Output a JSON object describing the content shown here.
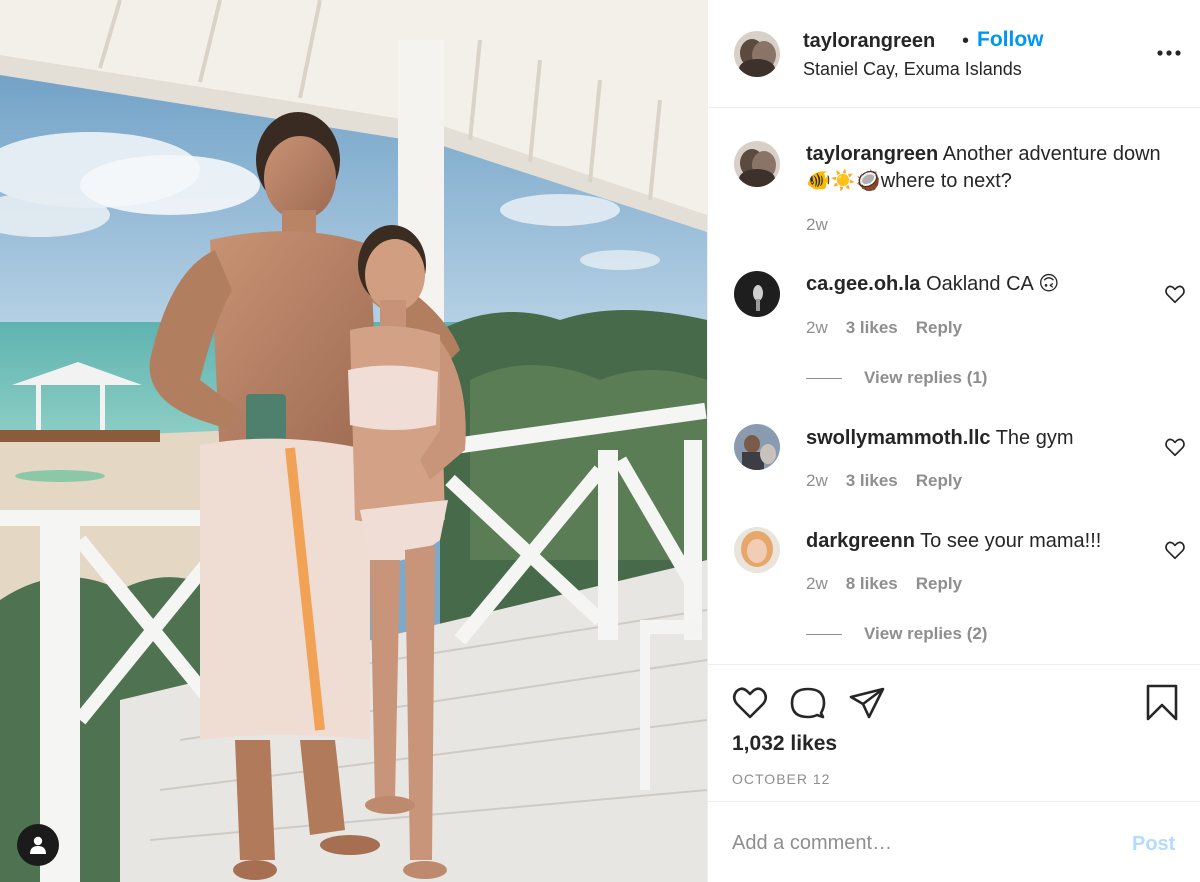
{
  "post": {
    "username": "taylorangreen",
    "follow_label": "Follow",
    "separator": "•",
    "location": "Staniel Cay, Exuma Islands",
    "more_icon": "more-horizontal-icon",
    "caption": {
      "username": "taylorangreen",
      "text": "Another adventure down🐠☀️🥥where to next?",
      "age": "2w"
    }
  },
  "comments": [
    {
      "username": "ca.gee.oh.la",
      "text": "Oakland CA 🙃",
      "age": "2w",
      "likes": "3 likes",
      "reply_label": "Reply",
      "view_replies": "View replies (1)"
    },
    {
      "username": "swollymammoth.llc",
      "text": "The gym",
      "age": "2w",
      "likes": "3 likes",
      "reply_label": "Reply",
      "view_replies": ""
    },
    {
      "username": "darkgreenn",
      "text": "To see your mama!!!",
      "age": "2w",
      "likes": "8 likes",
      "reply_label": "Reply",
      "view_replies": "View replies (2)"
    }
  ],
  "actions": {
    "like_icon": "heart-icon",
    "comment_icon": "comment-bubble-icon",
    "share_icon": "paper-plane-icon",
    "save_icon": "bookmark-icon",
    "likes_count": "1,032 likes",
    "date": "OCTOBER 12"
  },
  "add_comment": {
    "placeholder": "Add a comment…",
    "post_label": "Post"
  },
  "colors": {
    "accent": "#0095f6",
    "muted": "#8e8e8e",
    "post_disabled": "#b3dbff",
    "text": "#262626"
  }
}
